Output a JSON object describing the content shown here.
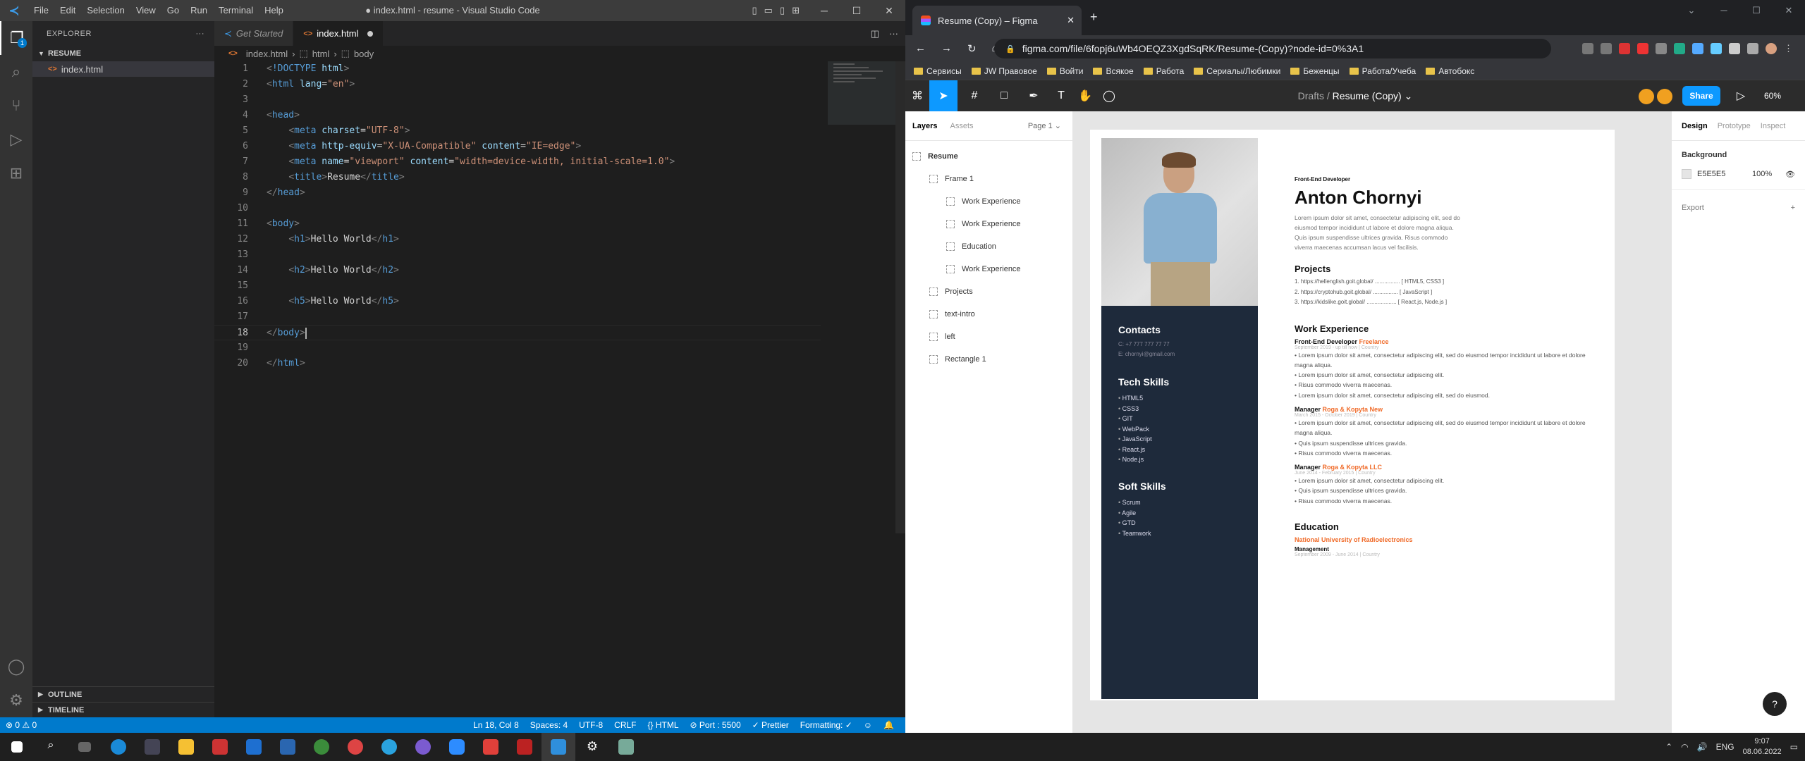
{
  "vscode": {
    "menu": [
      "File",
      "Edit",
      "Selection",
      "View",
      "Go",
      "Run",
      "Terminal",
      "Help"
    ],
    "window_title": "● index.html - resume - Visual Studio Code",
    "explorer_label": "EXPLORER",
    "folder": "RESUME",
    "file": "index.html",
    "outline": "OUTLINE",
    "timeline": "TIMELINE",
    "tab_get_started": "Get Started",
    "tab_index": "index.html",
    "breadcrumbs": [
      "index.html",
      "html",
      "body"
    ],
    "badge": "1",
    "code_lines": [
      {
        "n": "1",
        "html": "<span class='p'>&lt;</span><span class='t'>!DOCTYPE</span> <span class='a'>html</span><span class='p'>&gt;</span>"
      },
      {
        "n": "2",
        "html": "<span class='p'>&lt;</span><span class='t'>html</span> <span class='a'>lang</span>=<span class='s'>\"en\"</span><span class='p'>&gt;</span>"
      },
      {
        "n": "3",
        "html": ""
      },
      {
        "n": "4",
        "html": "<span class='p'>&lt;</span><span class='t'>head</span><span class='p'>&gt;</span>"
      },
      {
        "n": "5",
        "html": "    <span class='p'>&lt;</span><span class='t'>meta</span> <span class='a'>charset</span>=<span class='s'>\"UTF-8\"</span><span class='p'>&gt;</span>"
      },
      {
        "n": "6",
        "html": "    <span class='p'>&lt;</span><span class='t'>meta</span> <span class='a'>http-equiv</span>=<span class='s'>\"X-UA-Compatible\"</span> <span class='a'>content</span>=<span class='s'>\"IE=edge\"</span><span class='p'>&gt;</span>"
      },
      {
        "n": "7",
        "html": "    <span class='p'>&lt;</span><span class='t'>meta</span> <span class='a'>name</span>=<span class='s'>\"viewport\"</span> <span class='a'>content</span>=<span class='s'>\"width=device-width, initial-scale=1.0\"</span><span class='p'>&gt;</span>"
      },
      {
        "n": "8",
        "html": "    <span class='p'>&lt;</span><span class='t'>title</span><span class='p'>&gt;</span>Resume<span class='p'>&lt;/</span><span class='t'>title</span><span class='p'>&gt;</span>"
      },
      {
        "n": "9",
        "html": "<span class='p'>&lt;/</span><span class='t'>head</span><span class='p'>&gt;</span>"
      },
      {
        "n": "10",
        "html": ""
      },
      {
        "n": "11",
        "html": "<span class='p'>&lt;</span><span class='t'>body</span><span class='p'>&gt;</span>"
      },
      {
        "n": "12",
        "html": "    <span class='p'>&lt;</span><span class='t'>h1</span><span class='p'>&gt;</span>Hello World<span class='p'>&lt;/</span><span class='t'>h1</span><span class='p'>&gt;</span>"
      },
      {
        "n": "13",
        "html": ""
      },
      {
        "n": "14",
        "html": "    <span class='p'>&lt;</span><span class='t'>h2</span><span class='p'>&gt;</span>Hello World<span class='p'>&lt;/</span><span class='t'>h2</span><span class='p'>&gt;</span>"
      },
      {
        "n": "15",
        "html": ""
      },
      {
        "n": "16",
        "html": "    <span class='p'>&lt;</span><span class='t'>h5</span><span class='p'>&gt;</span>Hello World<span class='p'>&lt;/</span><span class='t'>h5</span><span class='p'>&gt;</span>"
      },
      {
        "n": "17",
        "html": ""
      },
      {
        "n": "18",
        "html": "<span class='p'>&lt;/</span><span class='t'>body</span><span class='p'>&gt;</span><span class='cursor'></span>"
      },
      {
        "n": "19",
        "html": ""
      },
      {
        "n": "20",
        "html": "<span class='p'>&lt;/</span><span class='t'>html</span><span class='p'>&gt;</span>"
      }
    ],
    "status": {
      "problems": "⊗ 0 ⚠ 0",
      "position": "Ln 18, Col 8",
      "spaces": "Spaces: 4",
      "encoding": "UTF-8",
      "eol": "CRLF",
      "lang": "{} HTML",
      "port": "⊘ Port : 5500",
      "prettier": "✓ Prettier",
      "formatting": "Formatting: ✓"
    }
  },
  "chrome": {
    "tab_title": "Resume (Copy) – Figma",
    "url": "figma.com/file/6fopj6uWb4OEQZ3XgdSqRK/Resume-(Copy)?node-id=0%3A1",
    "bookmarks": [
      "Сервисы",
      "JW Правовое",
      "Войти",
      "Всякое",
      "Работа",
      "Сериалы/Любимки",
      "Беженцы",
      "Работа/Учеба",
      "Автобокс"
    ]
  },
  "figma": {
    "breadcrumb_drafts": "Drafts",
    "breadcrumb_sep": "/",
    "file_name": "Resume (Copy)",
    "share": "Share",
    "zoom": "60%",
    "left_tabs": [
      "Layers",
      "Assets"
    ],
    "page": "Page 1",
    "layers": [
      {
        "name": "Resume",
        "indent": 0
      },
      {
        "name": "Frame 1",
        "indent": 1
      },
      {
        "name": "Work Experience",
        "indent": 2
      },
      {
        "name": "Work Experience",
        "indent": 2
      },
      {
        "name": "Education",
        "indent": 2
      },
      {
        "name": "Work Experience",
        "indent": 2
      },
      {
        "name": "Projects",
        "indent": 1
      },
      {
        "name": "text-intro",
        "indent": 1
      },
      {
        "name": "left",
        "indent": 1
      },
      {
        "name": "Rectangle 1",
        "indent": 1
      }
    ],
    "right_tabs": [
      "Design",
      "Prototype",
      "Inspect"
    ],
    "background_label": "Background",
    "bg_hex": "E5E5E5",
    "bg_opacity": "100%",
    "export_label": "Export"
  },
  "resume": {
    "role": "Front-End Developer",
    "name": "Anton Chornyi",
    "intro": "Lorem ipsum dolor sit amet, consectetur adipiscing elit, sed do eiusmod tempor incididunt ut labore et dolore magna aliqua. Quis ipsum suspendisse ultrices gravida. Risus commodo viverra maecenas accumsan lacus vel facilisis.",
    "contacts_title": "Contacts",
    "phone": "C:  +7 777 777 77 77",
    "email": "E:  chornyi@gmail.com",
    "tech_title": "Tech Skills",
    "tech": [
      "HTML5",
      "CSS3",
      "GIT",
      "WebPack",
      "JavaScript",
      "React.js",
      "Node.js"
    ],
    "soft_title": "Soft Skills",
    "soft": [
      "Scrum",
      "Agile",
      "GTD",
      "Teamwork"
    ],
    "projects_title": "Projects",
    "projects": [
      "1.  https://hellenglish.goit.global/ ................ [ HTML5, CSS3 ]",
      "2.  https://cryptohub.goit.global/ ................ [ JavaScript ]",
      "3.  https://kidslike.goit.global/ ................... [ React.js, Node.js ]"
    ],
    "work_title": "Work Experience",
    "job1_title": "Front-End Developer",
    "job1_company": "Freelance",
    "job1_dates": "September 2019 - up till now  |  Country",
    "job1_bullets": [
      "Lorem ipsum dolor sit amet, consectetur adipiscing elit, sed do eiusmod tempor incididunt ut labore et dolore magna aliqua.",
      "Lorem ipsum dolor sit amet, consectetur adipiscing elit.",
      "Risus commodo viverra maecenas.",
      "Lorem ipsum dolor sit amet, consectetur adipiscing elit, sed do eiusmod."
    ],
    "job2_title": "Manager",
    "job2_company": "Roga & Kopyta New",
    "job2_dates": "March 2015 - October 2019  |  Country",
    "job2_bullets": [
      "Lorem ipsum dolor sit amet, consectetur adipiscing elit, sed do eiusmod tempor incididunt ut labore et dolore magna aliqua.",
      "Quis ipsum suspendisse ultrices gravida.",
      "Risus commodo viverra maecenas."
    ],
    "job3_title": "Manager",
    "job3_company": "Roga & Kopyta LLC",
    "job3_dates": "June 2014 - February 2015  |  Country",
    "job3_bullets": [
      "Lorem ipsum dolor sit amet, consectetur adipiscing elit.",
      "Quis ipsum suspendisse ultrices gravida.",
      "Risus commodo viverra maecenas."
    ],
    "edu_title": "Education",
    "edu_school": "National University of Radioelectronics",
    "edu_degree": "Management",
    "edu_dates": "September 2009 - June 2014  |  Country"
  },
  "taskbar": {
    "lang": "ENG",
    "time": "9:07",
    "date": "08.06.2022"
  }
}
